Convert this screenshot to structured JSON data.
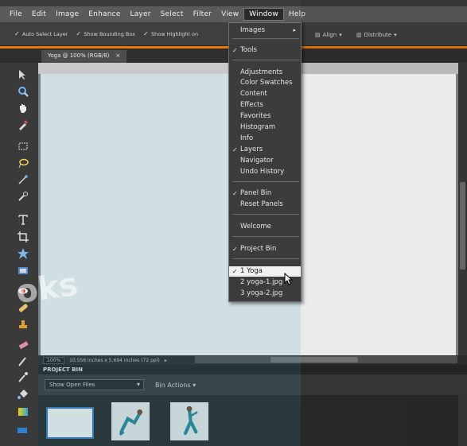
{
  "menu": [
    "File",
    "Edit",
    "Image",
    "Enhance",
    "Layer",
    "Select",
    "Filter",
    "View",
    "Window",
    "Help"
  ],
  "options": {
    "auto_select": "Auto Select Layer",
    "bounding_box": "Show Bounding Box",
    "highlight": "Show Highlight on",
    "align": "Align",
    "distribute": "Distribute"
  },
  "doc_tab": {
    "title": "Yoga @ 100% (RGB/8)",
    "close": "×"
  },
  "status": {
    "zoom": "100%",
    "size": "10.556 inches x 5.694 inches (72 ppi)"
  },
  "bin": {
    "title": "PROJECT BIN",
    "select_value": "Show Open Files",
    "actions": "Bin Actions"
  },
  "window_menu": {
    "images": "Images",
    "tools": "Tools",
    "adjustments": "Adjustments",
    "color_swatches": "Color Swatches",
    "content": "Content",
    "effects": "Effects",
    "favorites": "Favorites",
    "histogram": "Histogram",
    "info": "Info",
    "layers": "Layers",
    "navigator": "Navigator",
    "undo_history": "Undo History",
    "panel_bin": "Panel Bin",
    "reset_panels": "Reset Panels",
    "welcome": "Welcome",
    "project_bin": "Project Bin",
    "file1": "1 Yoga",
    "file2": "2 yoga-1.jpg",
    "file3": "3 yoga-2.jpg"
  },
  "watermark": "oks",
  "colors": {
    "accent": "#e8780f",
    "menu_highlight": "#f1f1f1",
    "selection": "#3a79c4"
  }
}
